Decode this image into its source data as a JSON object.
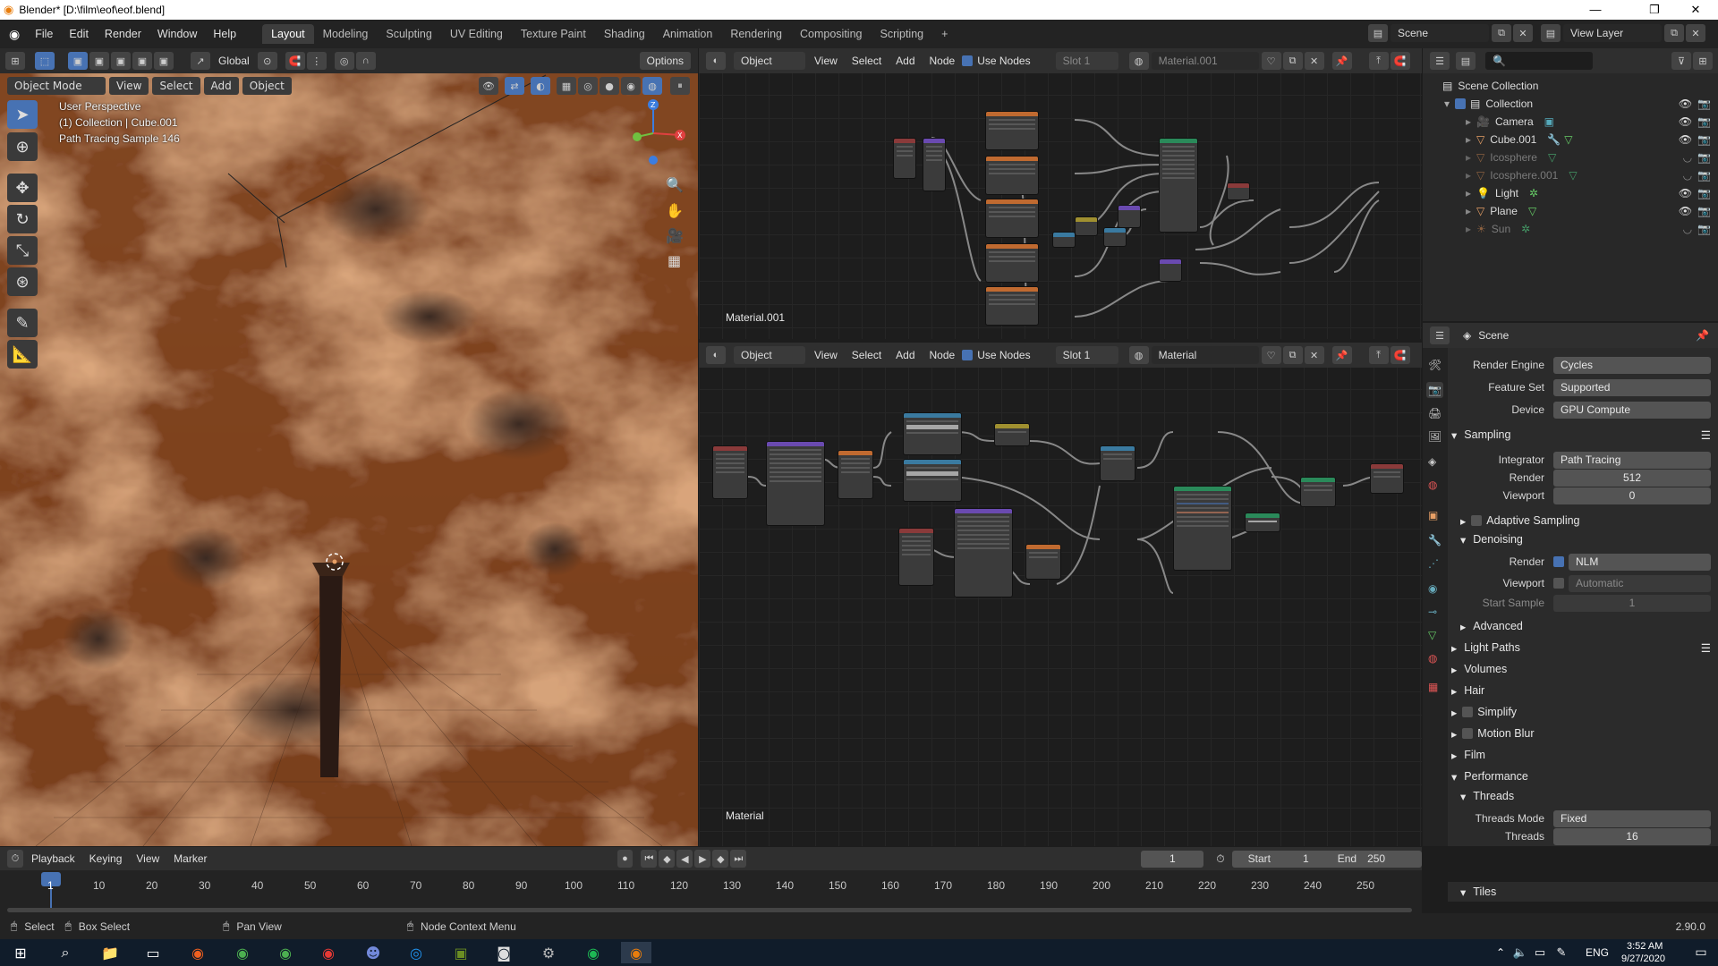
{
  "titlebar": {
    "title": "Blender* [D:\\film\\eof\\eof.blend]",
    "minimize": "—",
    "maximize": "❐",
    "close": "✕"
  },
  "menubar": {
    "menus": [
      "File",
      "Edit",
      "Render",
      "Window",
      "Help"
    ],
    "workspaces": [
      "Layout",
      "Modeling",
      "Sculpting",
      "UV Editing",
      "Texture Paint",
      "Shading",
      "Animation",
      "Rendering",
      "Compositing",
      "Scripting"
    ],
    "active_workspace": "Layout",
    "add_workspace": "+",
    "scene": "Scene",
    "view_layer": "View Layer"
  },
  "viewport": {
    "mode": "Object Mode",
    "menus": [
      "View",
      "Select",
      "Add",
      "Object"
    ],
    "transform_orientation": "Global",
    "options": "Options",
    "overlay_line1": "User Perspective",
    "overlay_line2": "(1) Collection | Cube.001",
    "overlay_line3": "Path Tracing Sample 146"
  },
  "node_editor_top": {
    "object_type": "Object",
    "menus": [
      "View",
      "Select",
      "Add",
      "Node"
    ],
    "use_nodes": "Use Nodes",
    "slot": "Slot 1",
    "material": "Material.001",
    "label": "Material.001"
  },
  "node_editor_bottom": {
    "object_type": "Object",
    "menus": [
      "View",
      "Select",
      "Add",
      "Node"
    ],
    "use_nodes": "Use Nodes",
    "slot": "Slot 1",
    "material": "Material",
    "label": "Material"
  },
  "outliner": {
    "root": "Scene Collection",
    "items": [
      {
        "label": "Collection",
        "icon": "collection-icon",
        "dim": false
      },
      {
        "label": "Camera",
        "icon": "camera-icon",
        "dim": false
      },
      {
        "label": "Cube.001",
        "icon": "mesh-icon",
        "dim": false
      },
      {
        "label": "Icosphere",
        "icon": "mesh-icon",
        "dim": true
      },
      {
        "label": "Icosphere.001",
        "icon": "mesh-icon",
        "dim": true
      },
      {
        "label": "Light",
        "icon": "light-icon",
        "dim": false
      },
      {
        "label": "Plane",
        "icon": "mesh-icon",
        "dim": false
      },
      {
        "label": "Sun",
        "icon": "sun-icon",
        "dim": true
      }
    ]
  },
  "properties": {
    "context": "Scene",
    "render_engine_label": "Render Engine",
    "render_engine": "Cycles",
    "feature_set_label": "Feature Set",
    "feature_set": "Supported",
    "device_label": "Device",
    "device": "GPU Compute",
    "sampling": "Sampling",
    "integrator_label": "Integrator",
    "integrator": "Path Tracing",
    "render_label": "Render",
    "render_samples": "512",
    "viewport_label": "Viewport",
    "viewport_samples": "0",
    "adaptive_sampling": "Adaptive Sampling",
    "denoising": "Denoising",
    "denoise_render_label": "Render",
    "denoise_render": "NLM",
    "denoise_viewport_label": "Viewport",
    "denoise_viewport": "Automatic",
    "start_sample_label": "Start Sample",
    "start_sample": "1",
    "advanced": "Advanced",
    "light_paths": "Light Paths",
    "volumes": "Volumes",
    "hair": "Hair",
    "simplify": "Simplify",
    "motion_blur": "Motion Blur",
    "film": "Film",
    "performance": "Performance",
    "threads": "Threads",
    "threads_mode_label": "Threads Mode",
    "threads_mode": "Fixed",
    "threads_count_label": "Threads",
    "threads_count": "16",
    "tiles": "Tiles"
  },
  "timeline": {
    "menus": [
      "Playback",
      "Keying",
      "View",
      "Marker"
    ],
    "current_frame": "1",
    "start_label": "Start",
    "start": "1",
    "end_label": "End",
    "end": "250",
    "ruler": [
      "1",
      "10",
      "20",
      "30",
      "40",
      "50",
      "60",
      "70",
      "80",
      "90",
      "100",
      "110",
      "120",
      "130",
      "140",
      "150",
      "160",
      "170",
      "180",
      "190",
      "200",
      "210",
      "220",
      "230",
      "240",
      "250"
    ]
  },
  "statusbar": {
    "select": "Select",
    "box_select": "Box Select",
    "pan_view": "Pan View",
    "node_context": "Node Context Menu",
    "version": "2.90.0"
  },
  "taskbar": {
    "lang": "ENG",
    "time": "3:52 AM",
    "date": "9/27/2020"
  },
  "colors": {
    "accent": "#4772b3",
    "cloud": "#b4693a",
    "header": "#2f2f2f"
  }
}
